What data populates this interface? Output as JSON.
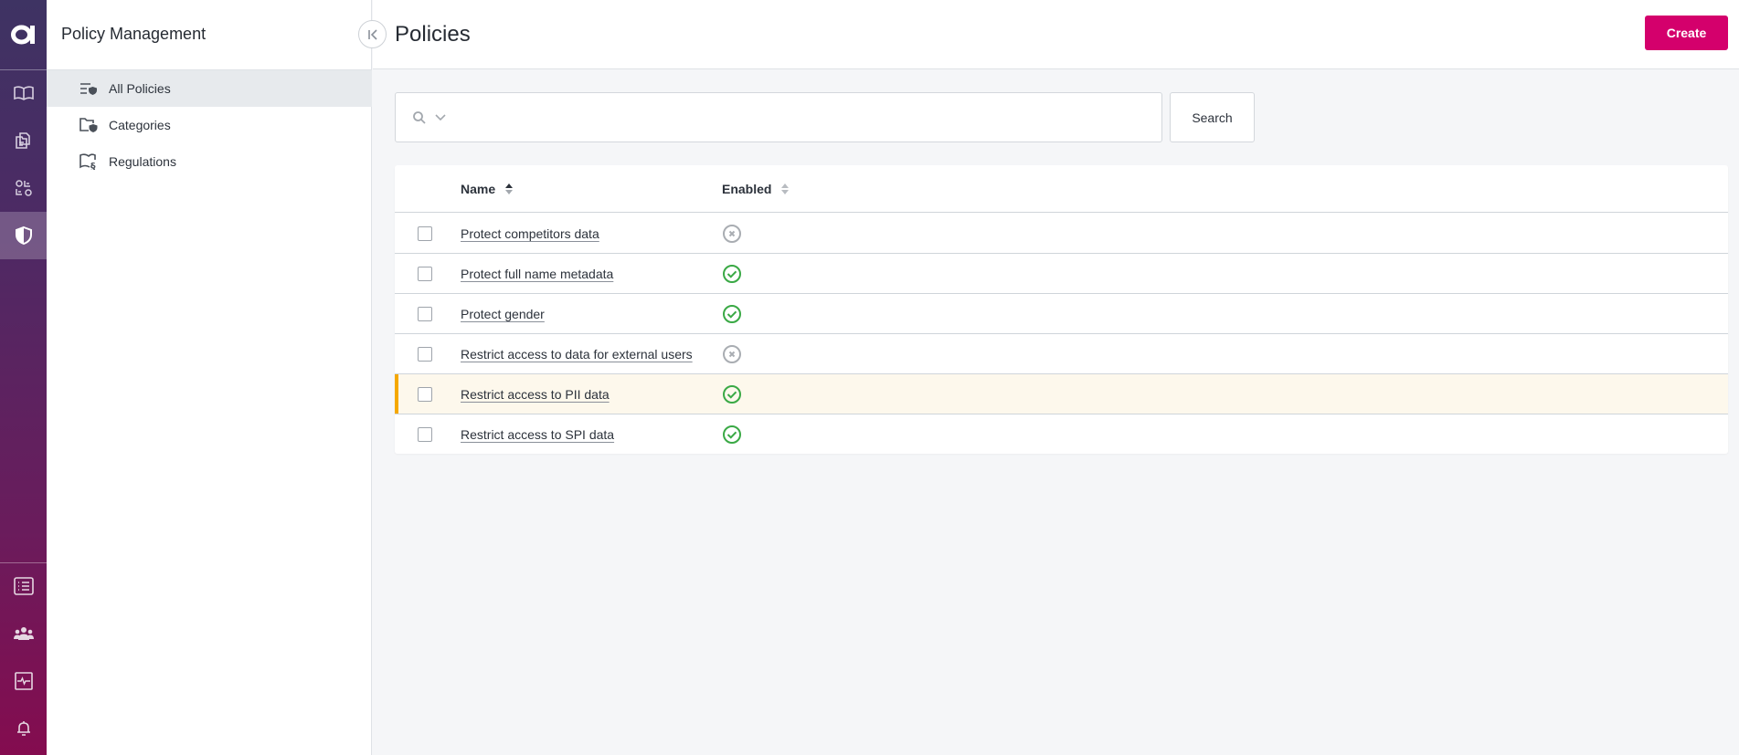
{
  "rail": {
    "logo": "a",
    "top_items": [
      {
        "icon": "book-icon",
        "label": "Catalog"
      },
      {
        "icon": "folder-files-icon",
        "label": "Data Sources"
      },
      {
        "icon": "shapes-grid-icon",
        "label": "Classification"
      },
      {
        "icon": "shield-icon",
        "label": "Policy Management",
        "active": true
      }
    ],
    "bottom_items": [
      {
        "icon": "list-icon",
        "label": "Audit"
      },
      {
        "icon": "users-icon",
        "label": "Users"
      },
      {
        "icon": "activity-monitor-icon",
        "label": "Monitoring"
      },
      {
        "icon": "bell-icon",
        "label": "Notifications"
      }
    ]
  },
  "sidebar": {
    "title": "Policy Management",
    "items": [
      {
        "label": "All Policies",
        "icon": "policies-list-icon",
        "active": true
      },
      {
        "label": "Categories",
        "icon": "folder-shield-icon",
        "active": false
      },
      {
        "label": "Regulations",
        "icon": "book-section-icon",
        "active": false
      }
    ]
  },
  "header": {
    "title": "Policies",
    "create_label": "Create"
  },
  "search": {
    "value": "",
    "placeholder": "",
    "button_label": "Search"
  },
  "table": {
    "columns": [
      {
        "label": "Name",
        "sort": "ascending"
      },
      {
        "label": "Enabled",
        "sort": "none"
      }
    ],
    "rows": [
      {
        "name": "Protect competitors data",
        "enabled": false,
        "checked": false,
        "highlighted": false
      },
      {
        "name": "Protect full name metadata",
        "enabled": true,
        "checked": false,
        "highlighted": false
      },
      {
        "name": "Protect gender",
        "enabled": true,
        "checked": false,
        "highlighted": false
      },
      {
        "name": "Restrict access to data for external users",
        "enabled": false,
        "checked": false,
        "highlighted": false
      },
      {
        "name": "Restrict access to PII data",
        "enabled": true,
        "checked": false,
        "highlighted": true
      },
      {
        "name": "Restrict access to SPI data",
        "enabled": true,
        "checked": false,
        "highlighted": false
      }
    ]
  },
  "colors": {
    "brand": "#d4006c",
    "enabled": "#3aa945",
    "disabled": "#a9adb2",
    "highlight_bar": "#f5a800",
    "highlight_bg": "#fdf8ec"
  }
}
